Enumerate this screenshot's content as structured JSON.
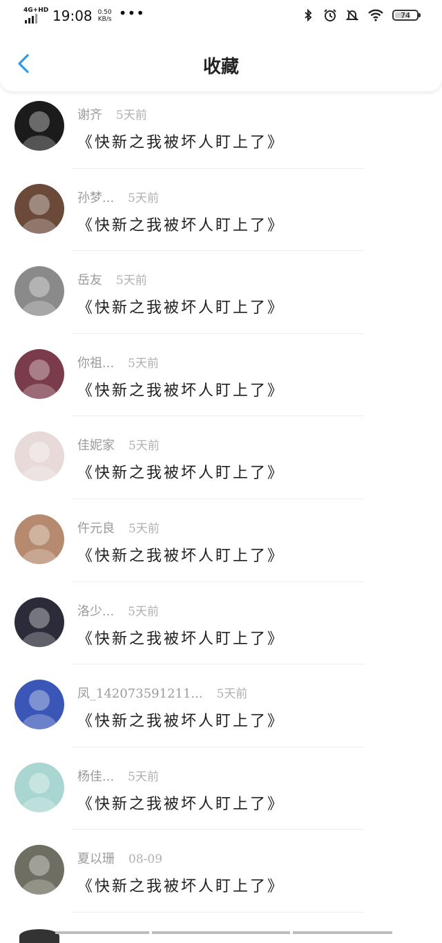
{
  "status_bar": {
    "network": "4G+HD",
    "time": "19:08",
    "speed_value": "0.50",
    "speed_unit": "KB/s",
    "more": "•••",
    "battery": "74",
    "battery_level": 0.74,
    "icons": [
      "bluetooth-icon",
      "alarm-icon",
      "mute-bell-icon",
      "wifi-icon"
    ]
  },
  "header": {
    "title": "收藏",
    "back_icon": "chevron-left-icon",
    "accent": "#2f9be6"
  },
  "items": [
    {
      "user": "谢齐",
      "time": "5天前",
      "book": "《快新之我被坏人盯上了》",
      "avatar_color": "#1b1b1b"
    },
    {
      "user": "孙梦...",
      "time": "5天前",
      "book": "《快新之我被坏人盯上了》",
      "avatar_color": "#6b4a3a"
    },
    {
      "user": "岳友",
      "time": "5天前",
      "book": "《快新之我被坏人盯上了》",
      "avatar_color": "#8a8a8a"
    },
    {
      "user": "你祖...",
      "time": "5天前",
      "book": "《快新之我被坏人盯上了》",
      "avatar_color": "#7a3b4a"
    },
    {
      "user": "佳妮家",
      "time": "5天前",
      "book": "《快新之我被坏人盯上了》",
      "avatar_color": "#e9dada"
    },
    {
      "user": "仵元良",
      "time": "5天前",
      "book": "《快新之我被坏人盯上了》",
      "avatar_color": "#b58a6e"
    },
    {
      "user": "洛少...",
      "time": "5天前",
      "book": "《快新之我被坏人盯上了》",
      "avatar_color": "#2b2b3a"
    },
    {
      "user": "凤_142073591211...",
      "time": "5天前",
      "book": "《快新之我被坏人盯上了》",
      "avatar_color": "#3a57b8"
    },
    {
      "user": "杨佳...",
      "time": "5天前",
      "book": "《快新之我被坏人盯上了》",
      "avatar_color": "#a9d6d0"
    },
    {
      "user": "夏以珊",
      "time": "08-09",
      "book": "《快新之我被坏人盯上了》",
      "avatar_color": "#6e6e62"
    }
  ]
}
